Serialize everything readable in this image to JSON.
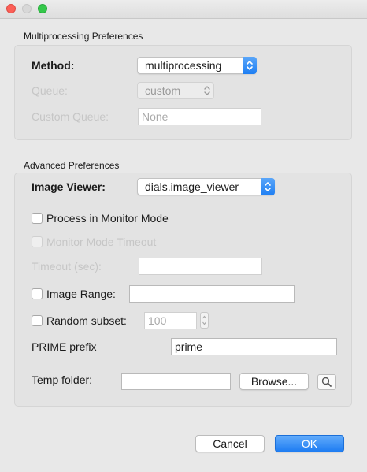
{
  "multiprocessing": {
    "section_title": "Multiprocessing Preferences",
    "method_label": "Method:",
    "method_value": "multiprocessing",
    "queue_label": "Queue:",
    "queue_value": "custom",
    "custom_queue_label": "Custom Queue:",
    "custom_queue_placeholder": "None"
  },
  "advanced": {
    "section_title": "Advanced Preferences",
    "image_viewer_label": "Image Viewer:",
    "image_viewer_value": "dials.image_viewer",
    "monitor_mode_label": "Process in Monitor Mode",
    "monitor_mode_checked": false,
    "monitor_timeout_label": "Monitor Mode Timeout",
    "monitor_timeout_checked": false,
    "timeout_label": "Timeout (sec):",
    "timeout_value": "",
    "image_range_label": "Image Range:",
    "image_range_checked": false,
    "image_range_value": "",
    "random_subset_label": "Random subset:",
    "random_subset_checked": false,
    "random_subset_placeholder": "100",
    "prime_prefix_label": "PRIME prefix",
    "prime_prefix_value": "prime",
    "temp_folder_label": "Temp folder:",
    "temp_folder_value": "",
    "browse_label": "Browse..."
  },
  "footer": {
    "cancel_label": "Cancel",
    "ok_label": "OK"
  },
  "colors": {
    "accent": "#1d7cf2",
    "close_light": "#fc5f57",
    "maximize_light": "#34c84a",
    "window_bg": "#e8e8e8"
  }
}
